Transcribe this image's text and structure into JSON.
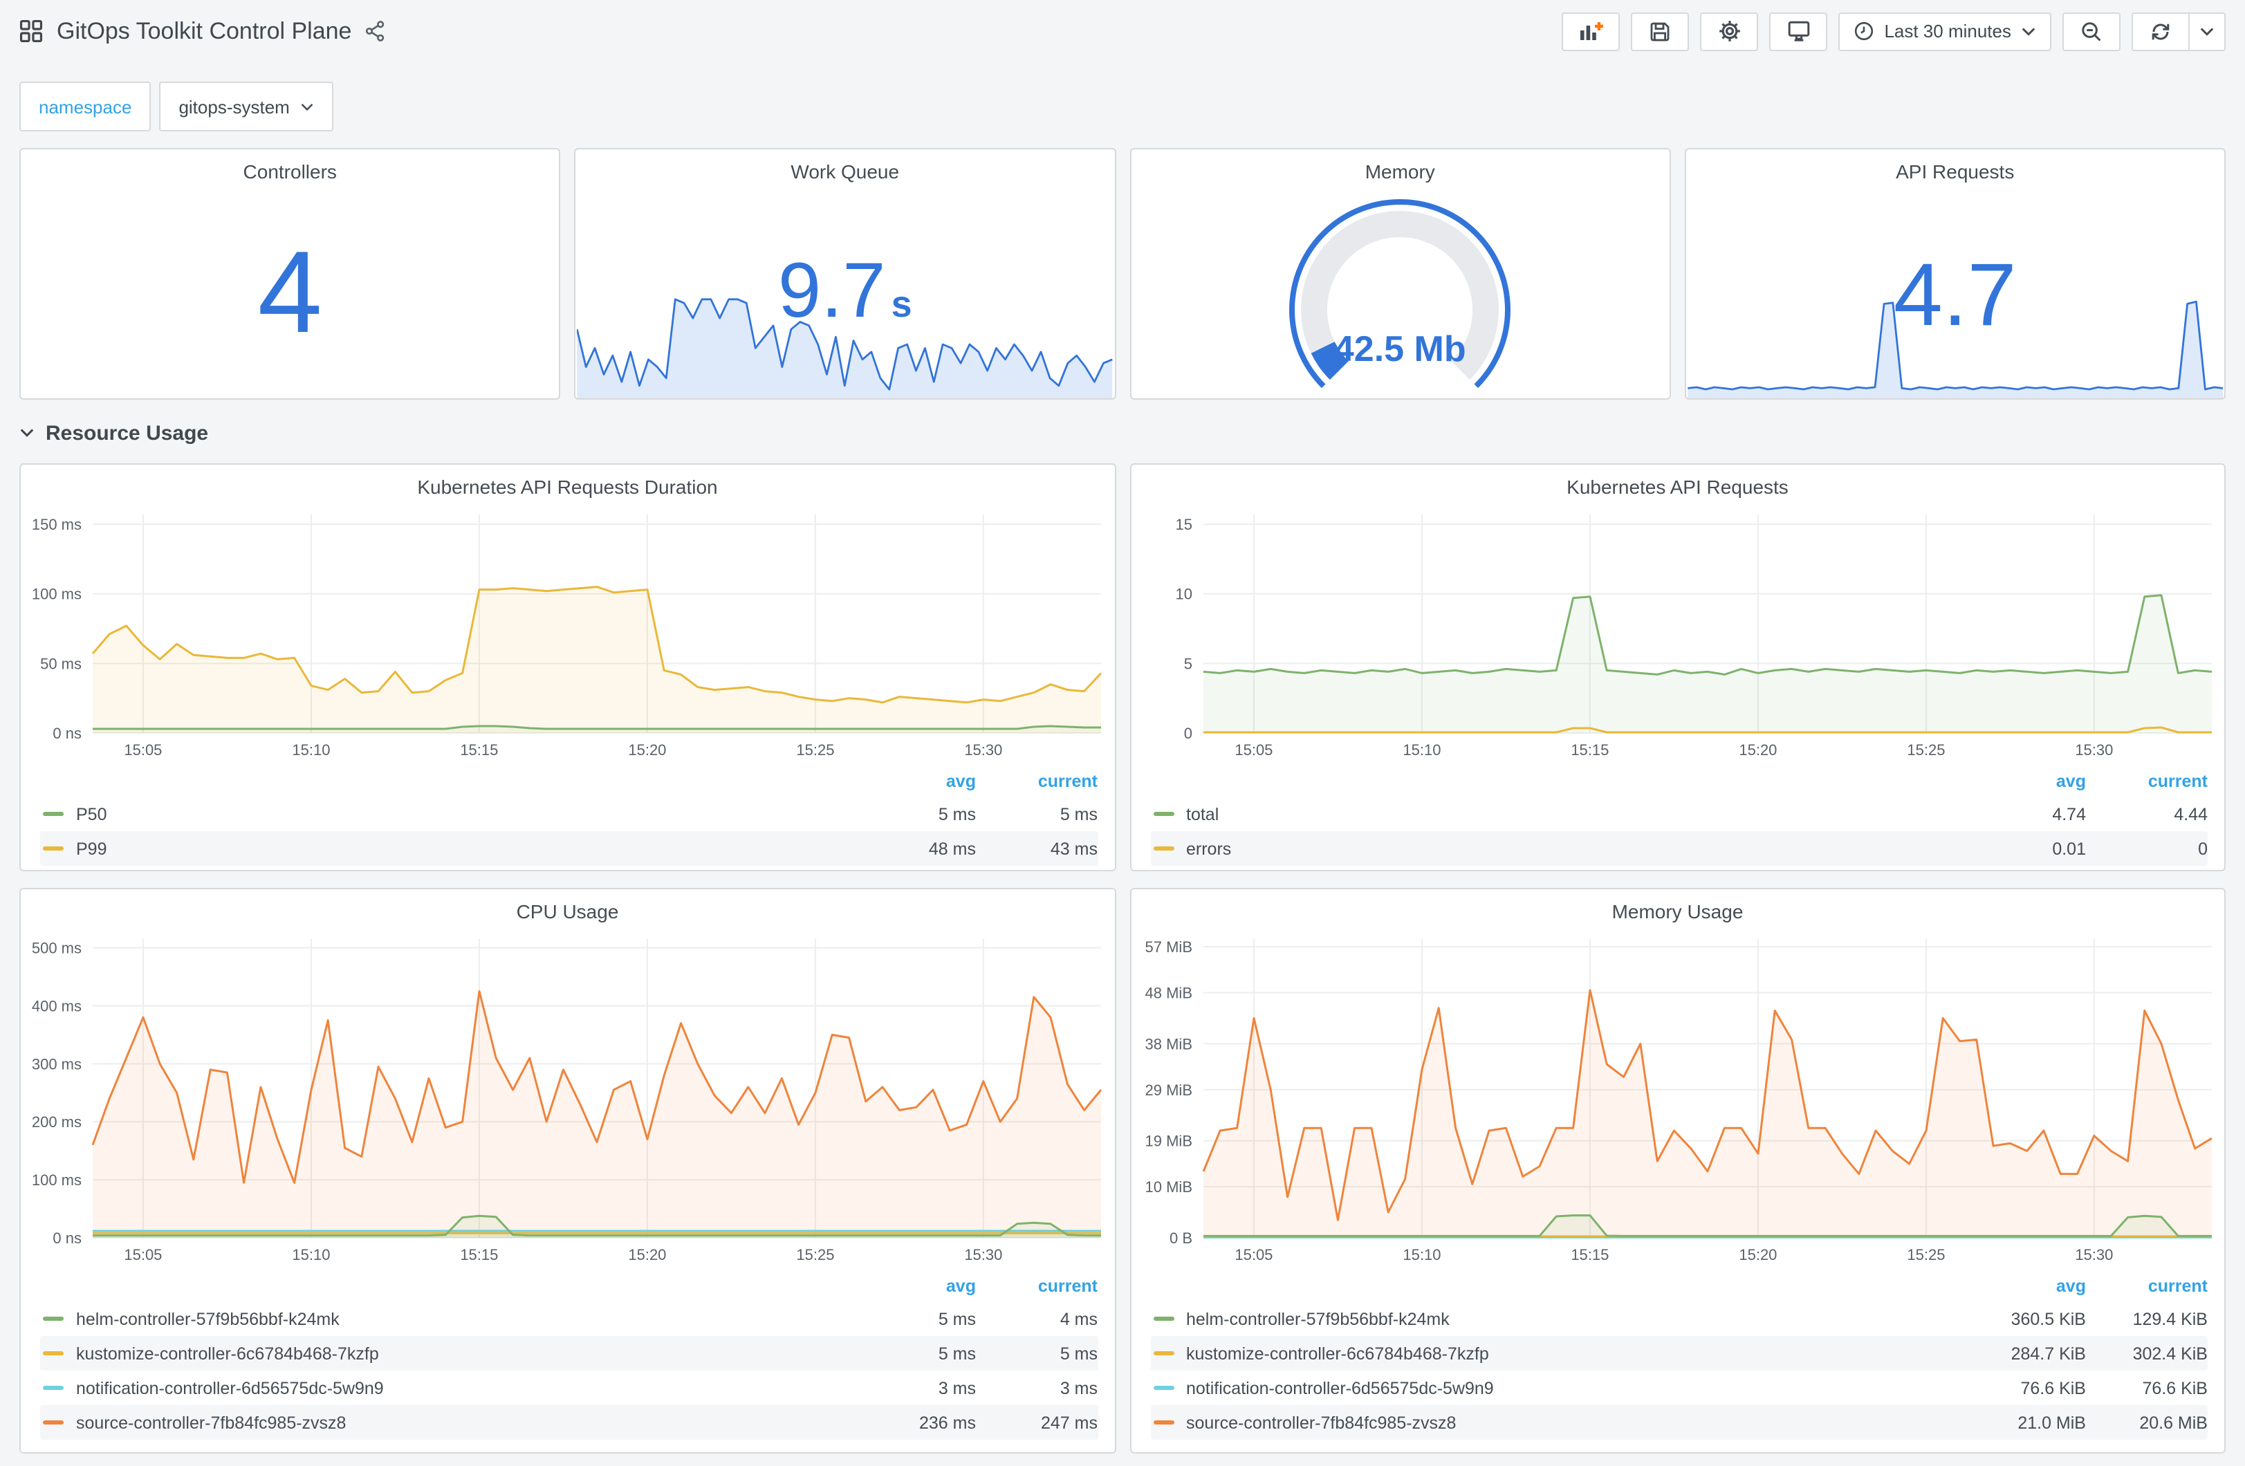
{
  "header": {
    "title": "GitOps Toolkit Control Plane",
    "time_range": "Last 30 minutes",
    "icons": {
      "left": [
        "apps-grid-icon",
        "share-alt-icon"
      ],
      "right": [
        "add-panel-icon",
        "save-icon",
        "gear-icon",
        "tv-mode-icon",
        "clock-icon",
        "zoom-out-icon",
        "refresh-icon",
        "chevron-down-icon"
      ]
    }
  },
  "variables": {
    "label": "namespace",
    "value": "gitops-system"
  },
  "row_section": {
    "title": "Resource Usage"
  },
  "colors": {
    "stat_blue": "#3274d9",
    "link_blue": "#33a2e5",
    "green": "#7EB26D",
    "yellow": "#EAB839",
    "light_blue": "#6ED0E0",
    "orange": "#EF843C"
  },
  "legend": {
    "avg": "avg",
    "current": "current"
  },
  "stats": {
    "controllers": {
      "title": "Controllers",
      "value": "4"
    },
    "work_queue": {
      "title": "Work Queue",
      "value": "9.7",
      "unit": "s",
      "spark": {
        "ylim": 14,
        "color": "#3274d9",
        "fill": "rgba(50,116,217,0.16)",
        "height": 80,
        "values": [
          9,
          4,
          6.5,
          3,
          5.5,
          2,
          6,
          1.5,
          5,
          4,
          2.5,
          13,
          12.5,
          10.5,
          13,
          13,
          10.5,
          13,
          13,
          12.5,
          6.5,
          8,
          9.5,
          4,
          9,
          10,
          9.5,
          7,
          3,
          8,
          1.5,
          7.5,
          5,
          6,
          2.5,
          1,
          6.5,
          7,
          3.5,
          6.5,
          2,
          7,
          6.5,
          4.5,
          7,
          6,
          3.5,
          6.5,
          5,
          7,
          5.5,
          3.5,
          6,
          2.5,
          1.5,
          4.5,
          5.5,
          4,
          2,
          4.5,
          5
        ]
      }
    },
    "memory": {
      "title": "Memory",
      "value": "42.5 Mb",
      "gauge": {
        "fraction": 0.07,
        "color": "#3274d9",
        "track": "#e7e9ed"
      }
    },
    "api_requests": {
      "title": "API Requests",
      "value": "4.7",
      "spark": {
        "ylim": 4.6,
        "color": "#3274d9",
        "fill": "rgba(50,116,217,0.16)",
        "height": 76,
        "values": [
          0.4,
          0.45,
          0.35,
          0.45,
          0.4,
          0.35,
          0.45,
          0.4,
          0.45,
          0.35,
          0.4,
          0.45,
          0.4,
          0.35,
          0.45,
          0.4,
          0.45,
          0.4,
          0.35,
          0.45,
          0.4,
          0.45,
          4.3,
          4.35,
          0.4,
          0.35,
          0.45,
          0.4,
          0.35,
          0.45,
          0.4,
          0.45,
          0.35,
          0.45,
          0.4,
          0.45,
          0.4,
          0.35,
          0.45,
          0.4,
          0.45,
          0.35,
          0.4,
          0.45,
          0.4,
          0.35,
          0.45,
          0.4,
          0.45,
          0.4,
          0.35,
          0.45,
          0.4,
          0.45,
          0.35,
          0.4,
          4.3,
          4.4,
          0.35,
          0.45,
          0.4
        ]
      }
    }
  },
  "chart_data": [
    {
      "type": "line",
      "title": "Kubernetes API Requests Duration",
      "ylim": 157,
      "y_ticks": [
        {
          "v": 0,
          "label": "0 ns"
        },
        {
          "v": 50,
          "label": "50 ms"
        },
        {
          "v": 100,
          "label": "100 ms"
        },
        {
          "v": 150,
          "label": "150 ms"
        }
      ],
      "x_ticks": [
        {
          "f": 0.05,
          "label": "15:05"
        },
        {
          "f": 0.2167,
          "label": "15:10"
        },
        {
          "f": 0.3833,
          "label": "15:15"
        },
        {
          "f": 0.55,
          "label": "15:20"
        },
        {
          "f": 0.7167,
          "label": "15:25"
        },
        {
          "f": 0.8833,
          "label": "15:30"
        }
      ],
      "x_range": [
        "15:03:30",
        "15:33:30"
      ],
      "draw_order": [
        1,
        0
      ],
      "series": [
        {
          "name": "P50",
          "color": "#7EB26D",
          "fill_opacity": 0.08,
          "avg": "5 ms",
          "current": "5 ms",
          "gen": {
            "base": 3,
            "n": 61,
            "set": {
              "22": 4.5,
              "23": 5,
              "24": 5,
              "25": 4.5,
              "26": 3.5,
              "56": 4.5,
              "57": 5,
              "58": 4.5,
              "59": 4,
              "60": 4
            }
          }
        },
        {
          "name": "P99",
          "color": "#EAB839",
          "fill_opacity": 0.1,
          "avg": "48 ms",
          "current": "43 ms",
          "values": [
            57,
            71,
            77,
            63,
            53,
            64,
            56,
            55,
            54,
            54,
            57,
            53,
            54,
            34,
            31,
            39,
            29,
            30,
            44,
            29,
            30,
            38,
            43,
            103,
            103,
            104,
            103,
            102,
            103,
            104,
            105,
            101,
            102,
            103,
            45,
            42,
            33,
            31,
            32,
            33,
            30,
            29,
            26,
            24,
            23,
            25,
            24,
            22,
            26,
            25,
            24,
            23,
            22,
            24,
            23,
            26,
            29,
            35,
            31,
            30,
            43
          ]
        }
      ]
    },
    {
      "type": "line",
      "title": "Kubernetes API Requests",
      "ylim": 15.7,
      "y_ticks": [
        {
          "v": 0,
          "label": "0"
        },
        {
          "v": 5,
          "label": "5"
        },
        {
          "v": 10,
          "label": "10"
        },
        {
          "v": 15,
          "label": "15"
        }
      ],
      "x_ticks": [
        {
          "f": 0.05,
          "label": "15:05"
        },
        {
          "f": 0.2167,
          "label": "15:10"
        },
        {
          "f": 0.3833,
          "label": "15:15"
        },
        {
          "f": 0.55,
          "label": "15:20"
        },
        {
          "f": 0.7167,
          "label": "15:25"
        },
        {
          "f": 0.8833,
          "label": "15:30"
        }
      ],
      "x_range": [
        "15:03:30",
        "15:33:30"
      ],
      "draw_order": [
        0,
        1
      ],
      "series": [
        {
          "name": "total",
          "color": "#7EB26D",
          "fill_opacity": 0.09,
          "avg": "4.74",
          "current": "4.44",
          "values": [
            4.4,
            4.3,
            4.5,
            4.4,
            4.6,
            4.4,
            4.3,
            4.5,
            4.4,
            4.3,
            4.5,
            4.4,
            4.6,
            4.3,
            4.4,
            4.5,
            4.3,
            4.4,
            4.6,
            4.5,
            4.4,
            4.5,
            9.7,
            9.8,
            4.5,
            4.4,
            4.3,
            4.2,
            4.5,
            4.3,
            4.4,
            4.2,
            4.6,
            4.3,
            4.5,
            4.6,
            4.4,
            4.6,
            4.5,
            4.4,
            4.6,
            4.5,
            4.4,
            4.5,
            4.4,
            4.3,
            4.5,
            4.4,
            4.5,
            4.4,
            4.3,
            4.4,
            4.5,
            4.4,
            4.3,
            4.4,
            9.8,
            9.9,
            4.3,
            4.5,
            4.4
          ]
        },
        {
          "name": "errors",
          "color": "#EAB839",
          "fill_opacity": 0,
          "avg": "0.01",
          "current": "0",
          "gen": {
            "base": 0.05,
            "n": 61,
            "set": {
              "22": 0.35,
              "23": 0.35,
              "56": 0.35,
              "57": 0.4
            }
          }
        }
      ]
    },
    {
      "type": "line",
      "title": "CPU Usage",
      "ylim": 515,
      "y_ticks": [
        {
          "v": 0,
          "label": "0 ns"
        },
        {
          "v": 100,
          "label": "100 ms"
        },
        {
          "v": 200,
          "label": "200 ms"
        },
        {
          "v": 300,
          "label": "300 ms"
        },
        {
          "v": 400,
          "label": "400 ms"
        },
        {
          "v": 500,
          "label": "500 ms"
        }
      ],
      "x_ticks": [
        {
          "f": 0.05,
          "label": "15:05"
        },
        {
          "f": 0.2167,
          "label": "15:10"
        },
        {
          "f": 0.3833,
          "label": "15:15"
        },
        {
          "f": 0.55,
          "label": "15:20"
        },
        {
          "f": 0.7167,
          "label": "15:25"
        },
        {
          "f": 0.8833,
          "label": "15:30"
        }
      ],
      "x_range": [
        "15:03:30",
        "15:33:30"
      ],
      "draw_order": [
        3,
        2,
        1,
        0
      ],
      "series": [
        {
          "name": "helm-controller-57f9b56bbf-k24mk",
          "color": "#7EB26D",
          "fill_opacity": 0.1,
          "avg": "5 ms",
          "current": "4 ms",
          "gen": {
            "base": 4,
            "n": 61,
            "set": {
              "21": 5,
              "22": 35,
              "23": 38,
              "24": 36,
              "25": 5,
              "55": 24,
              "56": 26,
              "57": 24,
              "58": 5
            }
          }
        },
        {
          "name": "kustomize-controller-6c6784b468-7kzfp",
          "color": "#EAB839",
          "fill_opacity": 0.1,
          "avg": "5 ms",
          "current": "5 ms",
          "gen": {
            "base": 8,
            "n": 61,
            "set": {}
          }
        },
        {
          "name": "notification-controller-6d56575dc-5w9n9",
          "color": "#6ED0E0",
          "fill_opacity": 0.1,
          "avg": "3 ms",
          "current": "3 ms",
          "gen": {
            "base": 12,
            "n": 61,
            "set": {}
          }
        },
        {
          "name": "source-controller-7fb84fc985-zvsz8",
          "color": "#EF843C",
          "fill_opacity": 0.09,
          "avg": "236 ms",
          "current": "247 ms",
          "values": [
            160,
            240,
            310,
            380,
            300,
            250,
            135,
            290,
            285,
            95,
            260,
            170,
            95,
            255,
            375,
            155,
            140,
            295,
            240,
            165,
            275,
            190,
            200,
            425,
            310,
            255,
            310,
            200,
            290,
            230,
            165,
            255,
            270,
            170,
            280,
            370,
            300,
            245,
            215,
            260,
            215,
            275,
            195,
            250,
            350,
            345,
            235,
            260,
            220,
            225,
            255,
            185,
            195,
            270,
            200,
            240,
            415,
            380,
            265,
            220,
            255
          ]
        }
      ]
    },
    {
      "type": "line",
      "title": "Memory Usage",
      "ylim": 58.5,
      "y_ticks": [
        {
          "v": 0,
          "label": "0 B"
        },
        {
          "v": 10,
          "label": "10 MiB"
        },
        {
          "v": 19,
          "label": "19 MiB"
        },
        {
          "v": 29,
          "label": "29 MiB"
        },
        {
          "v": 38,
          "label": "38 MiB"
        },
        {
          "v": 48,
          "label": "48 MiB"
        },
        {
          "v": 57,
          "label": "57 MiB"
        }
      ],
      "x_ticks": [
        {
          "f": 0.05,
          "label": "15:05"
        },
        {
          "f": 0.2167,
          "label": "15:10"
        },
        {
          "f": 0.3833,
          "label": "15:15"
        },
        {
          "f": 0.55,
          "label": "15:20"
        },
        {
          "f": 0.7167,
          "label": "15:25"
        },
        {
          "f": 0.8833,
          "label": "15:30"
        }
      ],
      "x_range": [
        "15:03:30",
        "15:33:30"
      ],
      "draw_order": [
        3,
        2,
        1,
        0
      ],
      "series": [
        {
          "name": "helm-controller-57f9b56bbf-k24mk",
          "color": "#7EB26D",
          "fill_opacity": 0.1,
          "avg": "360.5 KiB",
          "current": "129.4 KiB",
          "gen": {
            "base": 0.35,
            "n": 61,
            "set": {
              "21": 4.2,
              "22": 4.4,
              "23": 4.4,
              "24": 0.4,
              "55": 4.0,
              "56": 4.3,
              "57": 4.1
            }
          }
        },
        {
          "name": "kustomize-controller-6c6784b468-7kzfp",
          "color": "#EAB839",
          "fill_opacity": 0.1,
          "avg": "284.7 KiB",
          "current": "302.4 KiB",
          "gen": {
            "base": 0.28,
            "n": 61,
            "set": {}
          }
        },
        {
          "name": "notification-controller-6d56575dc-5w9n9",
          "color": "#6ED0E0",
          "fill_opacity": 0.1,
          "avg": "76.6 KiB",
          "current": "76.6 KiB",
          "gen": {
            "base": 0.08,
            "n": 61,
            "set": {}
          }
        },
        {
          "name": "source-controller-7fb84fc985-zvsz8",
          "color": "#EF843C",
          "fill_opacity": 0.09,
          "avg": "21.0 MiB",
          "current": "20.6 MiB",
          "values": [
            13,
            21,
            21.5,
            43,
            29,
            8,
            21.5,
            21.5,
            3.5,
            21.5,
            21.5,
            5,
            11.5,
            33,
            45,
            21.5,
            10.5,
            21,
            21.5,
            12,
            14,
            21.5,
            21.5,
            48.5,
            34,
            31.5,
            38,
            15,
            21,
            17.5,
            13,
            21.5,
            21.5,
            16.5,
            44.5,
            38.8,
            21.5,
            21.5,
            16.5,
            12.5,
            21,
            17,
            14.5,
            21,
            43,
            38.5,
            38.8,
            18,
            18.5,
            17,
            21,
            12.5,
            12.5,
            20,
            17,
            15,
            44.5,
            38,
            27,
            17.5,
            19.5
          ]
        }
      ]
    }
  ]
}
